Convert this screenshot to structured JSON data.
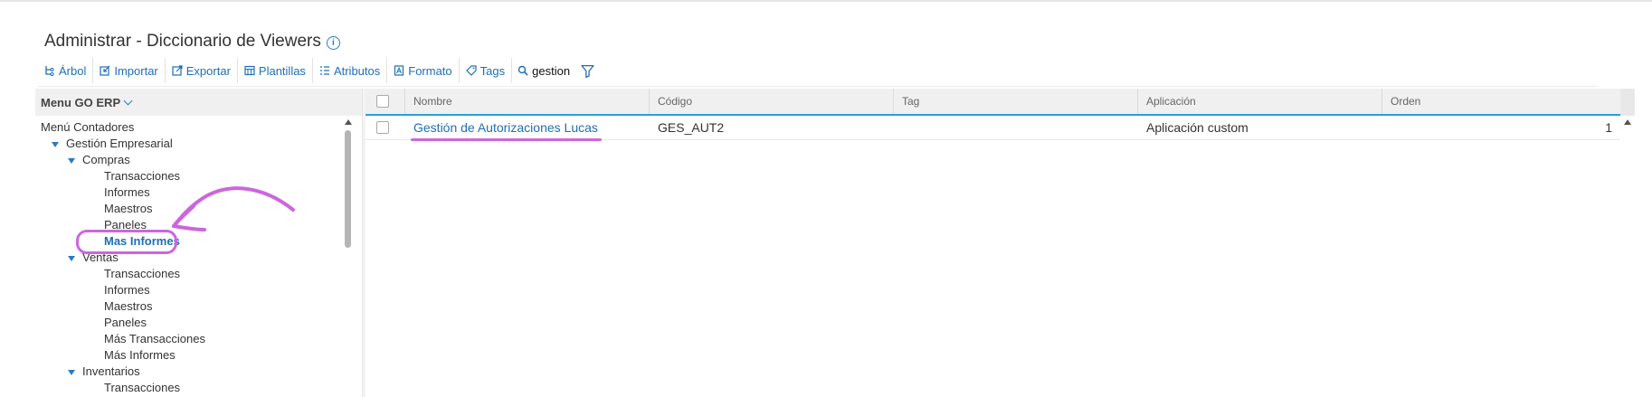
{
  "page": {
    "title": "Administrar - Diccionario de Viewers"
  },
  "toolbar": {
    "items": [
      {
        "label": "Árbol",
        "icon": "tree-icon"
      },
      {
        "label": "Importar",
        "icon": "import-icon"
      },
      {
        "label": "Exportar",
        "icon": "export-icon"
      },
      {
        "label": "Plantillas",
        "icon": "templates-icon"
      },
      {
        "label": "Atributos",
        "icon": "attributes-icon"
      },
      {
        "label": "Formato",
        "icon": "format-icon"
      },
      {
        "label": "Tags",
        "icon": "tag-icon"
      }
    ],
    "search_value": "gestion",
    "search_icon": "search-icon",
    "filter_icon": "filter-icon"
  },
  "left_panel": {
    "header": "Menu GO ERP",
    "tree": [
      {
        "label": "Menú Contadores",
        "level": 0,
        "caret": false
      },
      {
        "label": "Gestión Empresarial",
        "level": 1,
        "caret": true
      },
      {
        "label": "Compras",
        "level": 2,
        "caret": true
      },
      {
        "label": "Transacciones",
        "level": 3,
        "caret": false
      },
      {
        "label": "Informes",
        "level": 3,
        "caret": false
      },
      {
        "label": "Maestros",
        "level": 3,
        "caret": false
      },
      {
        "label": "Paneles",
        "level": 3,
        "caret": false
      },
      {
        "label": "Mas Informes",
        "level": 3,
        "caret": false,
        "selected": true
      },
      {
        "label": "Ventas",
        "level": 2,
        "caret": true
      },
      {
        "label": "Transacciones",
        "level": 3,
        "caret": false
      },
      {
        "label": "Informes",
        "level": 3,
        "caret": false
      },
      {
        "label": "Maestros",
        "level": 3,
        "caret": false
      },
      {
        "label": "Paneles",
        "level": 3,
        "caret": false
      },
      {
        "label": "Más Transacciones",
        "level": 3,
        "caret": false
      },
      {
        "label": "Más Informes",
        "level": 3,
        "caret": false
      },
      {
        "label": "Inventarios",
        "level": 2,
        "caret": true
      },
      {
        "label": "Transacciones",
        "level": 3,
        "caret": false
      }
    ]
  },
  "grid": {
    "columns": [
      "Nombre",
      "Código",
      "Tag",
      "Aplicación",
      "Orden"
    ],
    "rows": [
      {
        "nombre": "Gestión de Autorizaciones Lucas",
        "codigo": "GES_AUT2",
        "tag": "",
        "aplicacion": "Aplicación custom",
        "orden": "1"
      }
    ]
  },
  "colors": {
    "accent": "#1d6fb5",
    "annotation": "#cc66dd",
    "header_rule": "#2a9fd6"
  }
}
